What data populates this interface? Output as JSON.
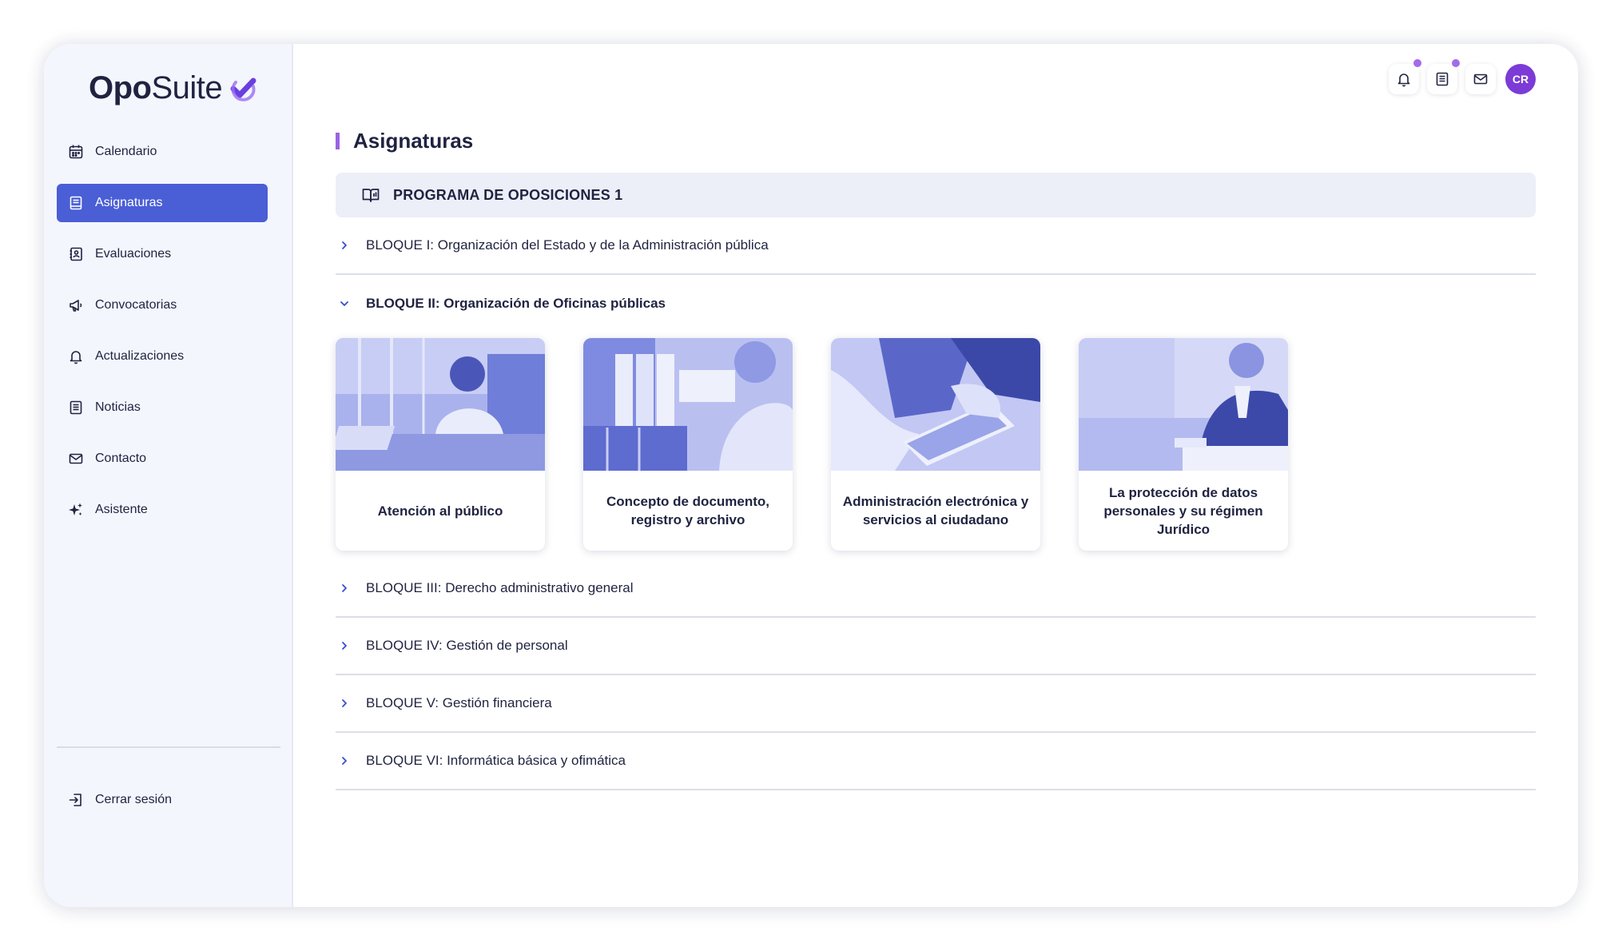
{
  "app": {
    "logo_text_bold": "Opo",
    "logo_text_light": "Suite",
    "brand_color": "#4a5ed6",
    "accent_color": "#9a63e3"
  },
  "sidebar": {
    "items": [
      {
        "label": "Calendario",
        "icon": "calendar-icon",
        "active": false
      },
      {
        "label": "Asignaturas",
        "icon": "book-icon",
        "active": true
      },
      {
        "label": "Evaluaciones",
        "icon": "clipboard-icon",
        "active": false
      },
      {
        "label": "Convocatorias",
        "icon": "megaphone-icon",
        "active": false
      },
      {
        "label": "Actualizaciones",
        "icon": "bell-icon",
        "active": false
      },
      {
        "label": "Noticias",
        "icon": "newspaper-icon",
        "active": false
      },
      {
        "label": "Contacto",
        "icon": "mail-icon",
        "active": false
      },
      {
        "label": "Asistente",
        "icon": "sparkles-icon",
        "active": false
      }
    ],
    "logout_label": "Cerrar sesión"
  },
  "topbar": {
    "notifications_icon": "bell-icon",
    "news_icon": "newspaper-icon",
    "messages_icon": "mail-icon",
    "avatar_initials": "CR"
  },
  "main": {
    "page_title": "Asignaturas",
    "program_title": "PROGRAMA DE OPOSICIONES 1",
    "blocks": [
      {
        "label": "BLOQUE I: Organización del Estado y de la Administración pública",
        "expanded": false
      },
      {
        "label": "BLOQUE II: Organización de Oficinas públicas",
        "expanded": true
      },
      {
        "label": "BLOQUE III: Derecho administrativo general",
        "expanded": false
      },
      {
        "label": "BLOQUE IV: Gestión de personal",
        "expanded": false
      },
      {
        "label": "BLOQUE V: Gestión financiera",
        "expanded": false
      },
      {
        "label": "BLOQUE VI: Informática básica y ofimática",
        "expanded": false
      }
    ],
    "subjects": [
      {
        "title": "Atención al público"
      },
      {
        "title": "Concepto de documento, registro y archivo"
      },
      {
        "title": "Administración electrónica y servicios al ciudadano"
      },
      {
        "title": "La protección de datos personales y su régimen Jurídico"
      }
    ]
  }
}
